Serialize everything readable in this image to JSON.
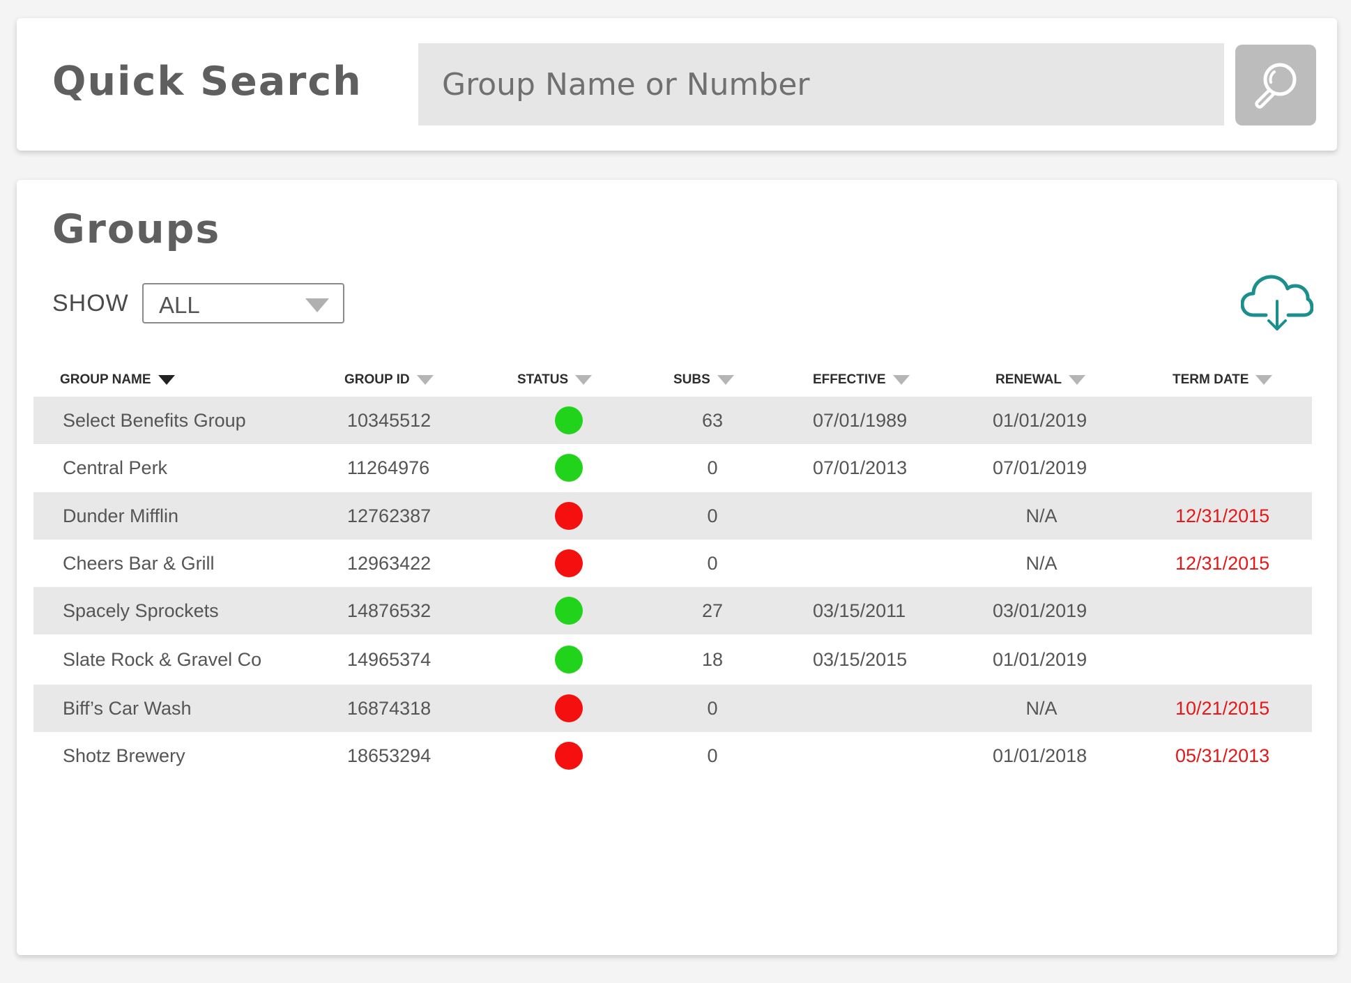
{
  "colors": {
    "active": "#22d31c",
    "inactive": "#f50f0f",
    "accent": "#1a8f8c",
    "term_date": "#e41818"
  },
  "quick_search": {
    "title": "Quick Search",
    "placeholder": "Group Name or Number",
    "value": "",
    "button_icon": "search-icon"
  },
  "groups": {
    "title": "Groups",
    "show_label": "SHOW",
    "show_value": "ALL",
    "download_icon": "cloud-download-icon",
    "columns": [
      {
        "label": "GROUP NAME",
        "sorted": true
      },
      {
        "label": "GROUP ID",
        "sorted": false
      },
      {
        "label": "STATUS",
        "sorted": false
      },
      {
        "label": "SUBS",
        "sorted": false
      },
      {
        "label": "EFFECTIVE",
        "sorted": false
      },
      {
        "label": "RENEWAL",
        "sorted": false
      },
      {
        "label": "TERM DATE",
        "sorted": false
      }
    ],
    "rows": [
      {
        "name": "Select Benefits Group",
        "id": "10345512",
        "status": "active",
        "subs": "63",
        "effective": "07/01/1989",
        "renewal": "01/01/2019",
        "term_date": ""
      },
      {
        "name": "Central Perk",
        "id": "11264976",
        "status": "active",
        "subs": "0",
        "effective": "07/01/2013",
        "renewal": "07/01/2019",
        "term_date": ""
      },
      {
        "name": "Dunder Mifflin",
        "id": "12762387",
        "status": "inactive",
        "subs": "0",
        "effective": "",
        "renewal": "N/A",
        "term_date": "12/31/2015"
      },
      {
        "name": "Cheers Bar & Grill",
        "id": "12963422",
        "status": "inactive",
        "subs": "0",
        "effective": "",
        "renewal": "N/A",
        "term_date": "12/31/2015"
      },
      {
        "name": "Spacely Sprockets",
        "id": "14876532",
        "status": "active",
        "subs": "27",
        "effective": "03/15/2011",
        "renewal": "03/01/2019",
        "term_date": ""
      },
      {
        "name": "Slate Rock & Gravel Co",
        "id": "14965374",
        "status": "active",
        "subs": "18",
        "effective": "03/15/2015",
        "renewal": "01/01/2019",
        "term_date": ""
      },
      {
        "name": "Biff’s Car Wash",
        "id": "16874318",
        "status": "inactive",
        "subs": "0",
        "effective": "",
        "renewal": "N/A",
        "term_date": "10/21/2015"
      },
      {
        "name": "Shotz Brewery",
        "id": "18653294",
        "status": "inactive",
        "subs": "0",
        "effective": "",
        "renewal": "01/01/2018",
        "term_date": "05/31/2013"
      }
    ]
  }
}
